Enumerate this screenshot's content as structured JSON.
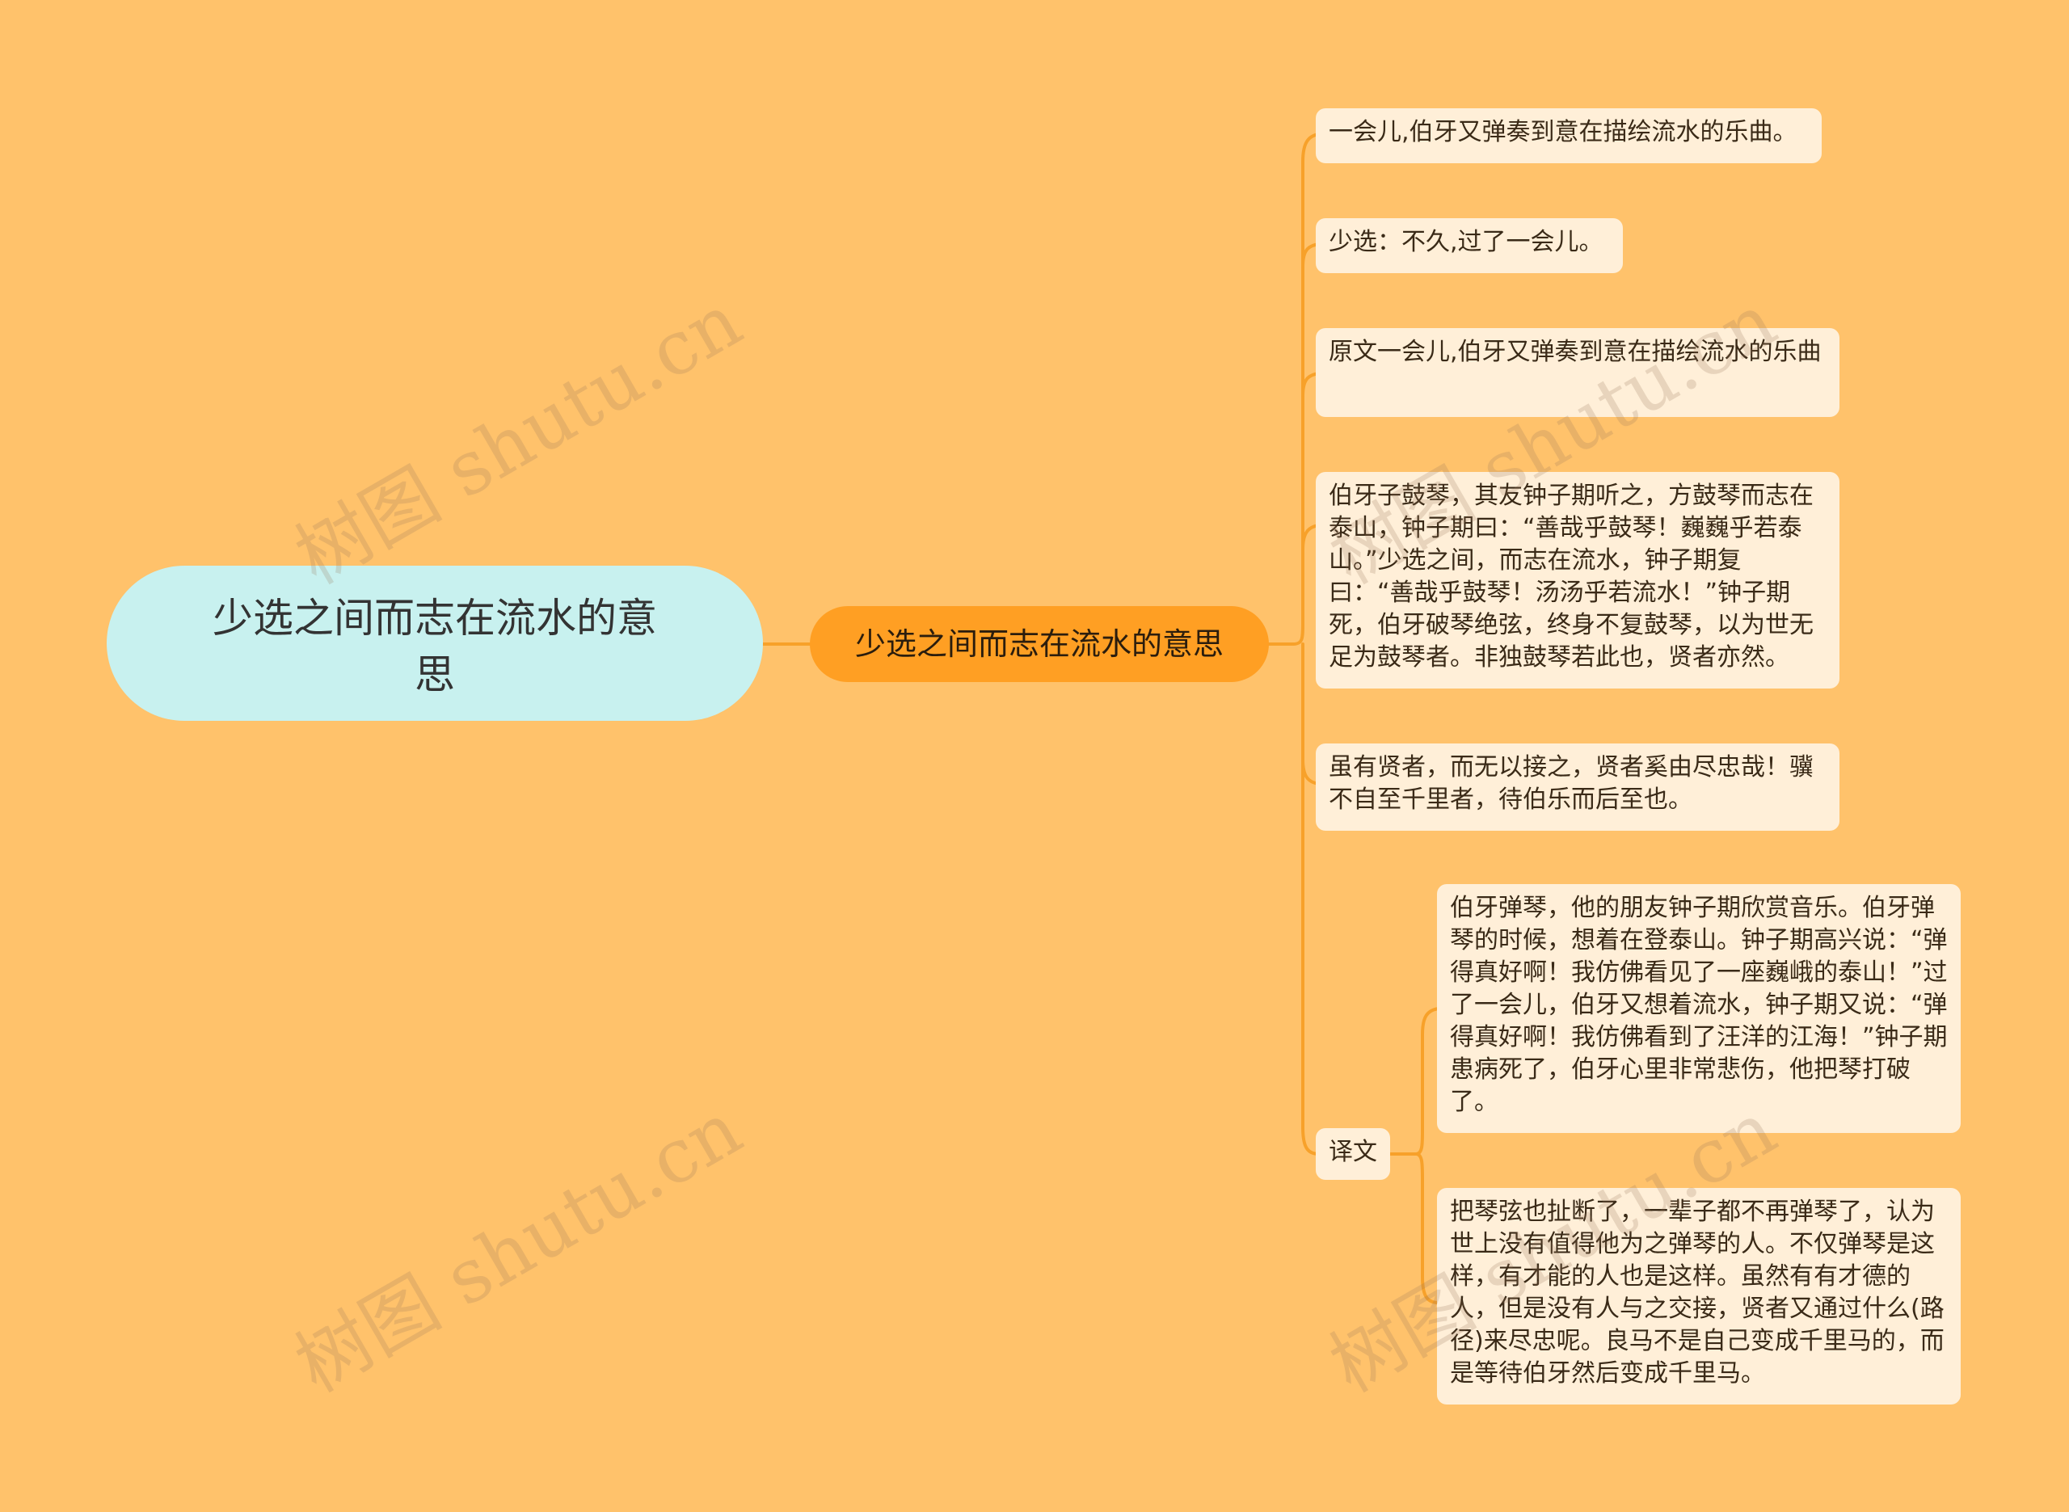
{
  "root": {
    "label": "少选之间而志在流水的意思"
  },
  "main": {
    "label": "少选之间而志在流水的意思"
  },
  "leaves": [
    {
      "text": "一会儿,伯牙又弹奏到意在描绘流水的乐曲。"
    },
    {
      "text": "少选：不久,过了一会儿。"
    },
    {
      "text": "原文一会儿,伯牙又弹奏到意在描绘流水的乐曲"
    },
    {
      "text": "伯牙子鼓琴，其友钟子期听之，方鼓琴而志在泰山，钟子期曰：“善哉乎鼓琴！巍巍乎若泰山。”少选之间，而志在流水，钟子期复曰：“善哉乎鼓琴！汤汤乎若流水！”钟子期死，伯牙破琴绝弦，终身不复鼓琴，以为世无足为鼓琴者。非独鼓琴若此也，贤者亦然。"
    },
    {
      "text": "虽有贤者，而无以接之，贤者奚由尽忠哉！骥不自至千里者，待伯乐而后至也。"
    }
  ],
  "translation": {
    "label": "译文",
    "children": [
      {
        "text": "伯牙弹琴，他的朋友钟子期欣赏音乐。伯牙弹琴的时候，想着在登泰山。钟子期高兴说：“弹得真好啊！我仿佛看见了一座巍峨的泰山！”过了一会儿，伯牙又想着流水，钟子期又说：“弹得真好啊！我仿佛看到了汪洋的江海！”钟子期患病死了，伯牙心里非常悲伤，他把琴打破了。"
      },
      {
        "text": "把琴弦也扯断了，一辈子都不再弹琴了，认为世上没有值得他为之弹琴的人。不仅弹琴是这样，有才能的人也是这样。虽然有有才德的人，但是没有人与之交接，贤者又通过什么(路径)来尽忠呢。良马不是自己变成千里马的，而是等待伯牙然后变成千里马。"
      }
    ]
  },
  "watermark": {
    "text": "树图 shutu.cn"
  },
  "colors": {
    "background": "#FFC26B",
    "root": "#C8F1EF",
    "main": "#FF9F23",
    "leaf": "#FFEFD8",
    "line": "#F7A12A"
  }
}
